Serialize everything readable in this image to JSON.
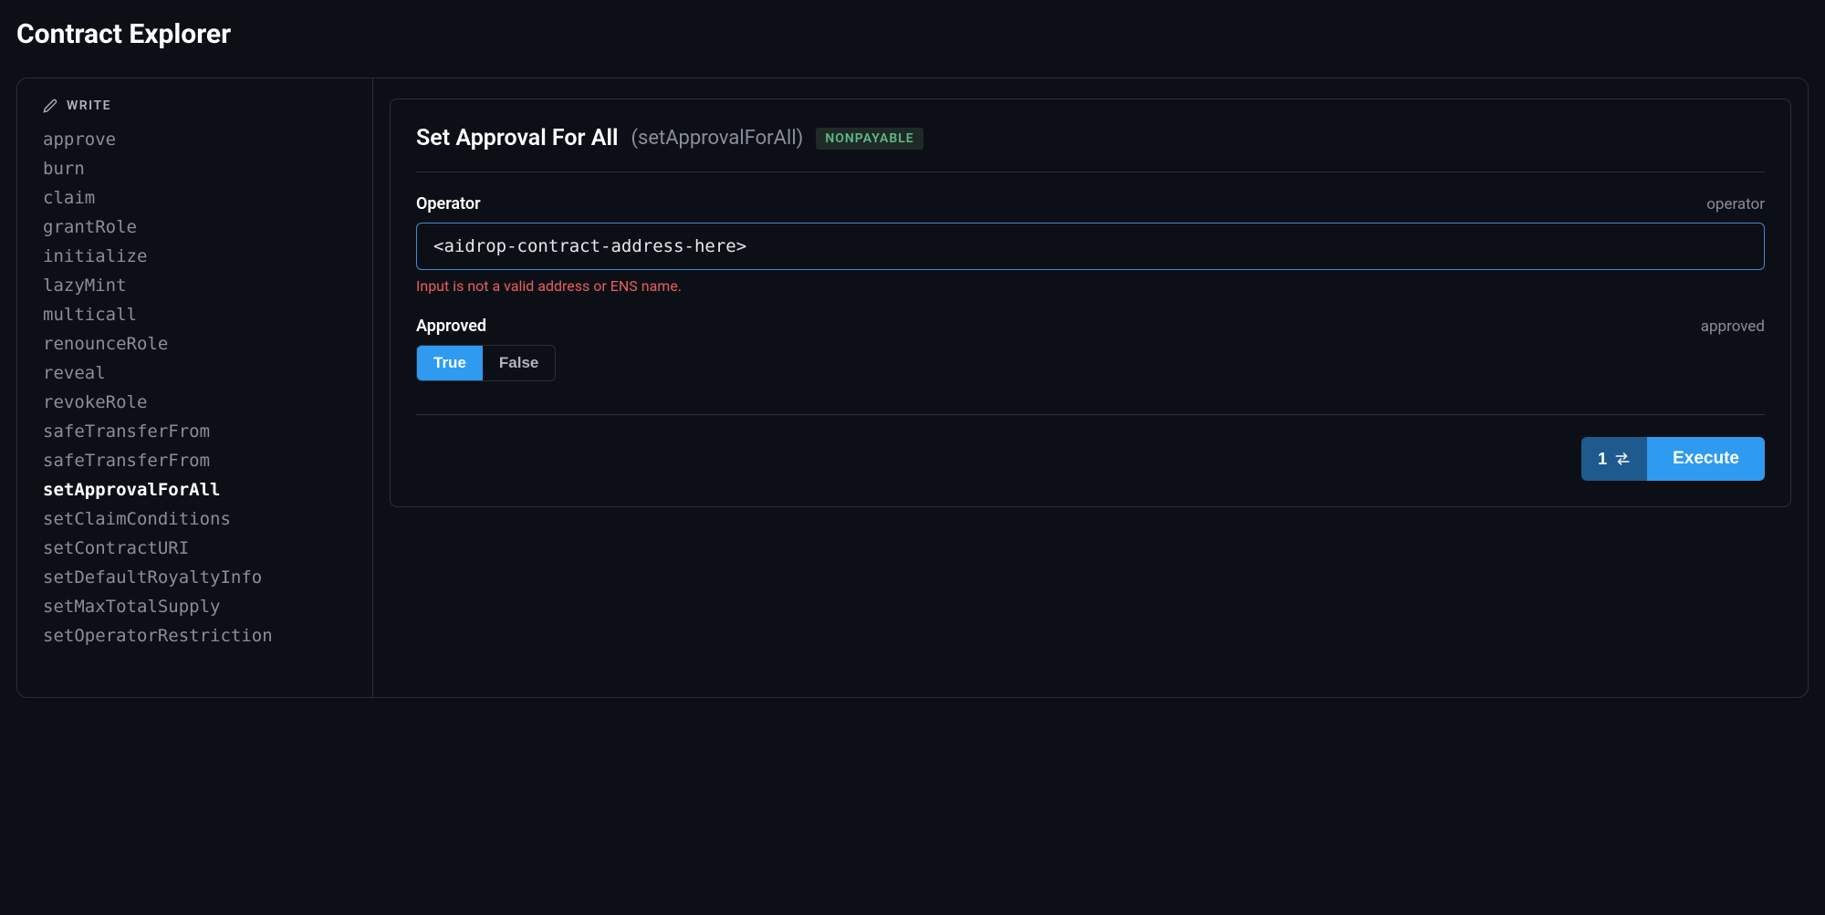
{
  "page": {
    "title": "Contract Explorer"
  },
  "sidebar": {
    "header": "WRITE",
    "items": [
      {
        "label": "approve",
        "active": false
      },
      {
        "label": "burn",
        "active": false
      },
      {
        "label": "claim",
        "active": false
      },
      {
        "label": "grantRole",
        "active": false
      },
      {
        "label": "initialize",
        "active": false
      },
      {
        "label": "lazyMint",
        "active": false
      },
      {
        "label": "multicall",
        "active": false
      },
      {
        "label": "renounceRole",
        "active": false
      },
      {
        "label": "reveal",
        "active": false
      },
      {
        "label": "revokeRole",
        "active": false
      },
      {
        "label": "safeTransferFrom",
        "active": false
      },
      {
        "label": "safeTransferFrom",
        "active": false
      },
      {
        "label": "setApprovalForAll",
        "active": true
      },
      {
        "label": "setClaimConditions",
        "active": false
      },
      {
        "label": "setContractURI",
        "active": false
      },
      {
        "label": "setDefaultRoyaltyInfo",
        "active": false
      },
      {
        "label": "setMaxTotalSupply",
        "active": false
      },
      {
        "label": "setOperatorRestriction",
        "active": false
      }
    ]
  },
  "card": {
    "title": "Set Approval For All",
    "subtitle": "(setApprovalForAll)",
    "badge": "NONPAYABLE",
    "operator": {
      "label": "Operator",
      "param": "operator",
      "value": "<aidrop-contract-address-here>",
      "error": "Input is not a valid address or ENS name."
    },
    "approved": {
      "label": "Approved",
      "param": "approved",
      "true_label": "True",
      "false_label": "False"
    },
    "footer": {
      "count": "1",
      "execute_label": "Execute"
    }
  }
}
